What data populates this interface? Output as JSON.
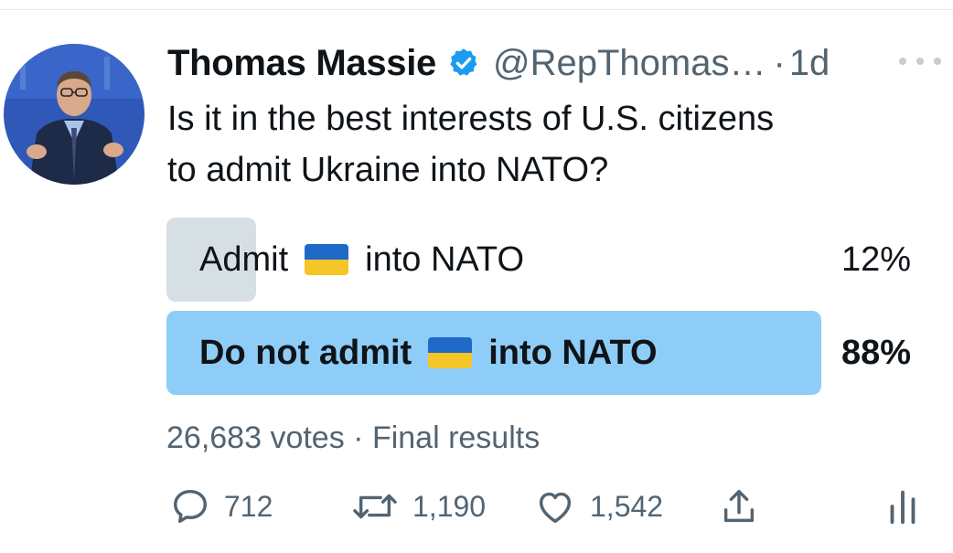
{
  "tweet": {
    "author_name": "Thomas Massie",
    "handle": "@RepThomas…",
    "separator": "·",
    "time": "1d",
    "text_line1": "Is it in the best interests of U.S. citizens",
    "text_line2": "to admit Ukraine into NATO?"
  },
  "poll": {
    "options": [
      {
        "before": "Admit",
        "after": "into NATO",
        "percent": "12%",
        "fill": 0.12
      },
      {
        "before": "Do not admit",
        "after": "into NATO",
        "percent": "88%",
        "fill": 0.88,
        "winner": true
      }
    ],
    "votes": "26,683 votes",
    "meta_separator": "·",
    "status": "Final results"
  },
  "actions": {
    "reply_count": "712",
    "retweet_count": "1,190",
    "like_count": "1,542"
  },
  "icons": [
    "verified-badge-icon",
    "more-icon",
    "reply-icon",
    "retweet-icon",
    "like-icon",
    "share-icon",
    "analytics-icon",
    "ukraine-flag-icon"
  ],
  "colors": {
    "verified": "#1d9bf0",
    "winner_bar": "#8ecdf8",
    "loser_bar": "#cfd9de",
    "muted_text": "#536471"
  }
}
